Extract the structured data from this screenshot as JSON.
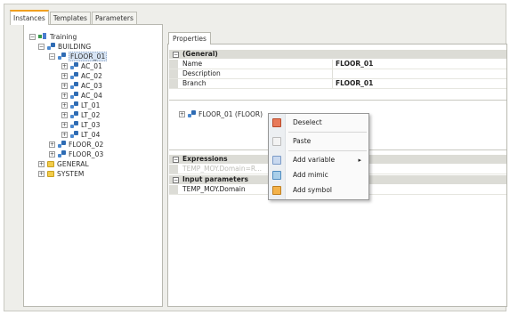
{
  "tabs": [
    "Instances",
    "Templates",
    "Parameters"
  ],
  "tree": {
    "root": "Training",
    "building": "BUILDING",
    "floor01": "FLOOR_01",
    "children": [
      "AC_01",
      "AC_02",
      "AC_03",
      "AC_04",
      "LT_01",
      "LT_02",
      "LT_03",
      "LT_04"
    ],
    "floor02": "FLOOR_02",
    "floor03": "FLOOR_03",
    "general": "GENERAL",
    "system": "SYSTEM"
  },
  "properties": {
    "tab_label": "Properties",
    "general_header": "(General)",
    "rows": [
      {
        "name": "Name",
        "value": "FLOOR_01"
      },
      {
        "name": "Description",
        "value": ""
      },
      {
        "name": "Branch",
        "value": "FLOOR_01"
      }
    ],
    "instance_label": "FLOOR_01 (FLOOR)",
    "expressions_header": "Expressions",
    "expression_row_name": "TEMP_MOY.Domain=R...",
    "input_params_header": "Input parameters",
    "input_row_name": "TEMP_MOY.Domain"
  },
  "context_menu": {
    "deselect": "Deselect",
    "paste": "Paste",
    "add_variable": "Add variable",
    "add_mimic": "Add mimic",
    "add_symbol": "Add symbol",
    "submenu_arrow": "▸"
  },
  "colors": {
    "accent_tab": "#f0a020",
    "selection": "#d7e4f4"
  }
}
